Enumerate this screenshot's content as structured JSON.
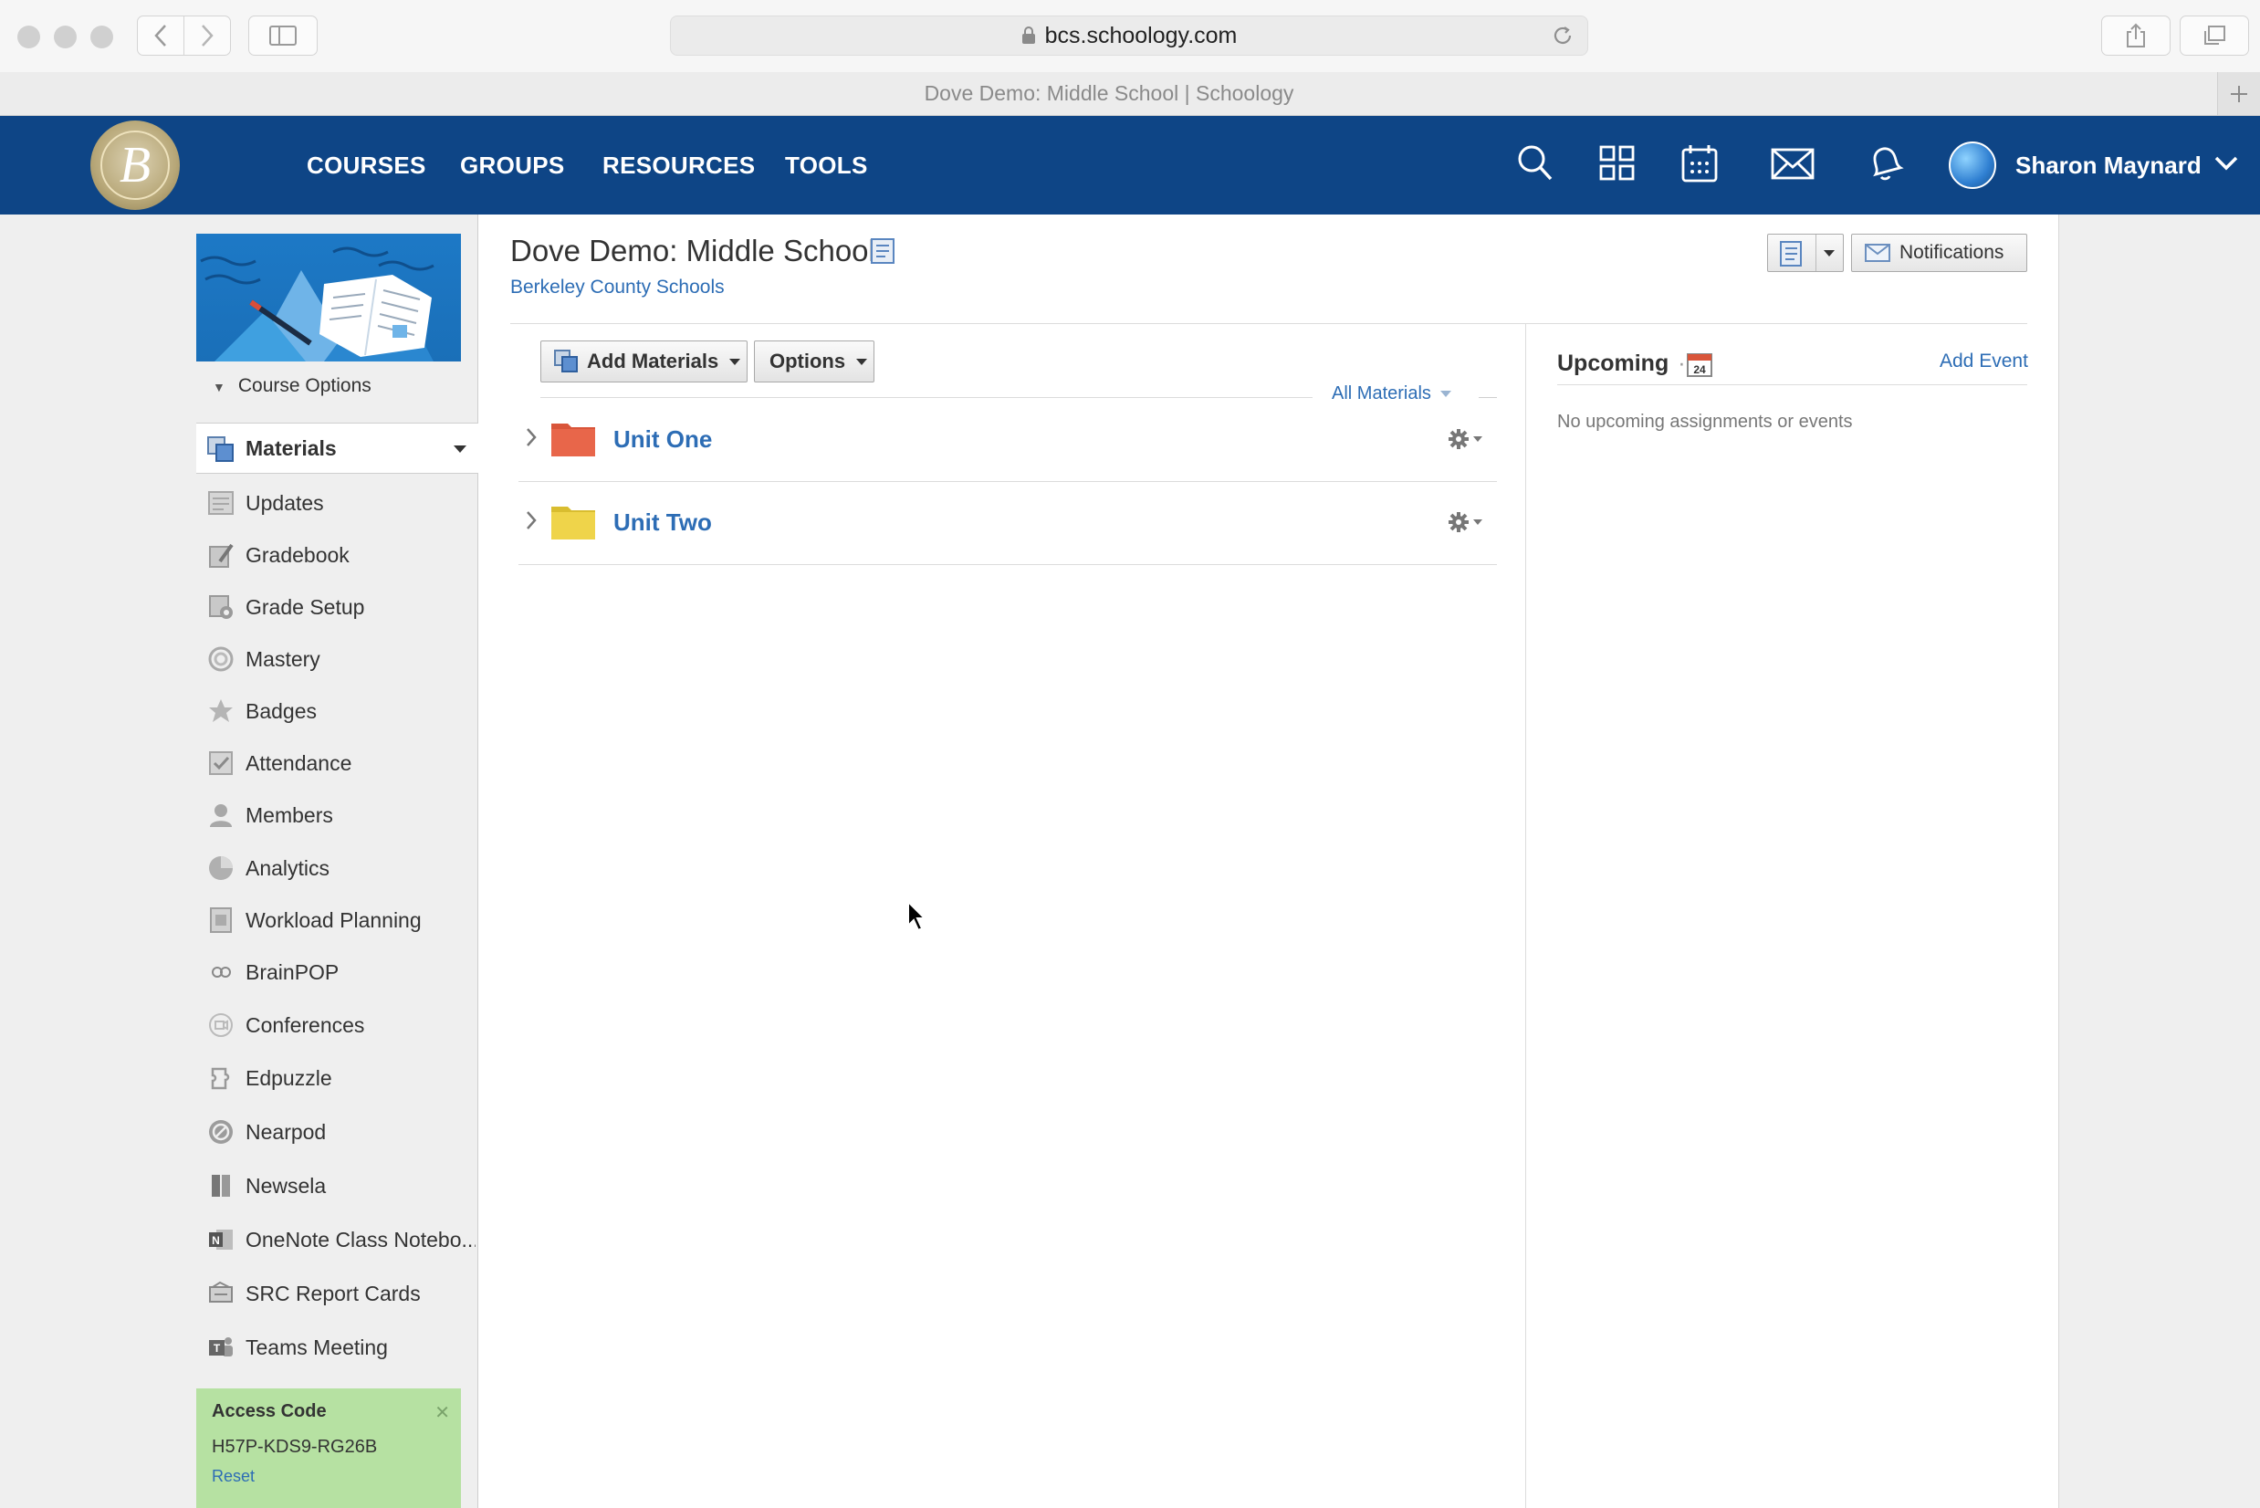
{
  "browser": {
    "url": "bcs.schoology.com",
    "tab_title": "Dove Demo: Middle School | Schoology"
  },
  "header": {
    "nav": [
      "COURSES",
      "GROUPS",
      "RESOURCES",
      "TOOLS"
    ],
    "user_name": "Sharon Maynard",
    "icons": [
      "search-icon",
      "apps-grid-icon",
      "calendar-icon",
      "mail-icon",
      "notifications-bell-icon"
    ],
    "brand_color": "#0e4586"
  },
  "sidebar": {
    "course_options": "Course Options",
    "active": "Materials",
    "items": [
      {
        "label": "Updates",
        "icon": "updates-icon"
      },
      {
        "label": "Gradebook",
        "icon": "gradebook-icon"
      },
      {
        "label": "Grade Setup",
        "icon": "grade-setup-icon"
      },
      {
        "label": "Mastery",
        "icon": "mastery-icon"
      },
      {
        "label": "Badges",
        "icon": "badge-icon"
      },
      {
        "label": "Attendance",
        "icon": "attendance-icon"
      },
      {
        "label": "Members",
        "icon": "members-icon"
      },
      {
        "label": "Analytics",
        "icon": "analytics-icon"
      },
      {
        "label": "Workload Planning",
        "icon": "workload-icon"
      },
      {
        "label": "BrainPOP",
        "icon": "brainpop-icon"
      },
      {
        "label": "Conferences",
        "icon": "conferences-icon"
      },
      {
        "label": "Edpuzzle",
        "icon": "edpuzzle-icon"
      },
      {
        "label": "Nearpod",
        "icon": "nearpod-icon"
      },
      {
        "label": "Newsela",
        "icon": "newsela-icon"
      },
      {
        "label": "OneNote Class Notebo...",
        "icon": "onenote-icon"
      },
      {
        "label": "SRC Report Cards",
        "icon": "report-cards-icon"
      },
      {
        "label": "Teams Meeting",
        "icon": "teams-icon"
      }
    ],
    "access_code": {
      "title": "Access Code",
      "code": "H57P-KDS9-RG26B",
      "reset": "Reset"
    }
  },
  "main": {
    "title": "Dove Demo: Middle School",
    "org": "Berkeley County Schools",
    "notifications_button": "Notifications",
    "add_materials": "Add Materials",
    "options": "Options",
    "filter": "All Materials",
    "folders": [
      {
        "name": "Unit One",
        "color": "#e8664a"
      },
      {
        "name": "Unit Two",
        "color": "#efd44a"
      }
    ]
  },
  "upcoming": {
    "title": "Upcoming",
    "calendar_day": "24",
    "add_event": "Add Event",
    "empty": "No upcoming assignments or events"
  }
}
